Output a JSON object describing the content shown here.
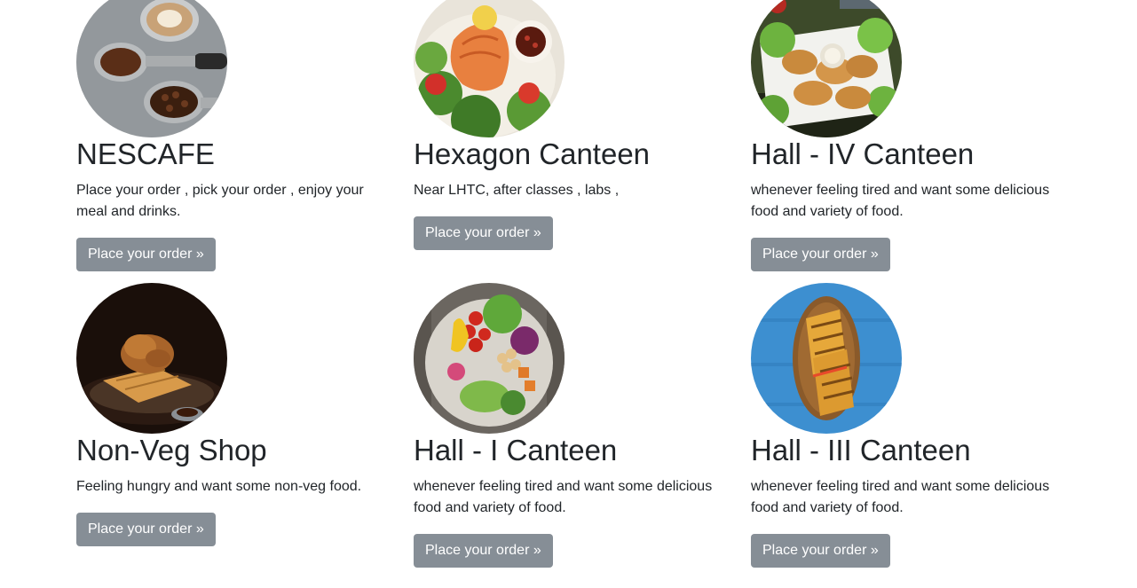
{
  "canteens": [
    {
      "name": "NESCAFE",
      "description": "Place your order , pick your order , enjoy your meal and drinks.",
      "button_label": "Place your order »",
      "image_icon": "coffee-image"
    },
    {
      "name": "Hexagon Canteen",
      "description": "Near LHTC, after classes , labs ,",
      "button_label": "Place your order »",
      "image_icon": "salmon-salad-image"
    },
    {
      "name": "Hall - IV Canteen",
      "description": "whenever feeling tired and want some delicious food and variety of food.",
      "button_label": "Place your order »",
      "image_icon": "fried-chicken-image"
    },
    {
      "name": "Non-Veg Shop",
      "description": "Feeling hungry and want some non-veg food.",
      "button_label": "Place your order »",
      "image_icon": "chicken-waffle-image"
    },
    {
      "name": "Hall - I Canteen",
      "description": "whenever feeling tired and want some delicious food and variety of food.",
      "button_label": "Place your order »",
      "image_icon": "veg-bowl-image"
    },
    {
      "name": "Hall - III Canteen",
      "description": "whenever feeling tired and want some delicious food and variety of food.",
      "button_label": "Place your order »",
      "image_icon": "sandwich-image"
    }
  ],
  "colors": {
    "button_bg": "#868e96",
    "button_text": "#ffffff",
    "heading_text": "#212529"
  }
}
